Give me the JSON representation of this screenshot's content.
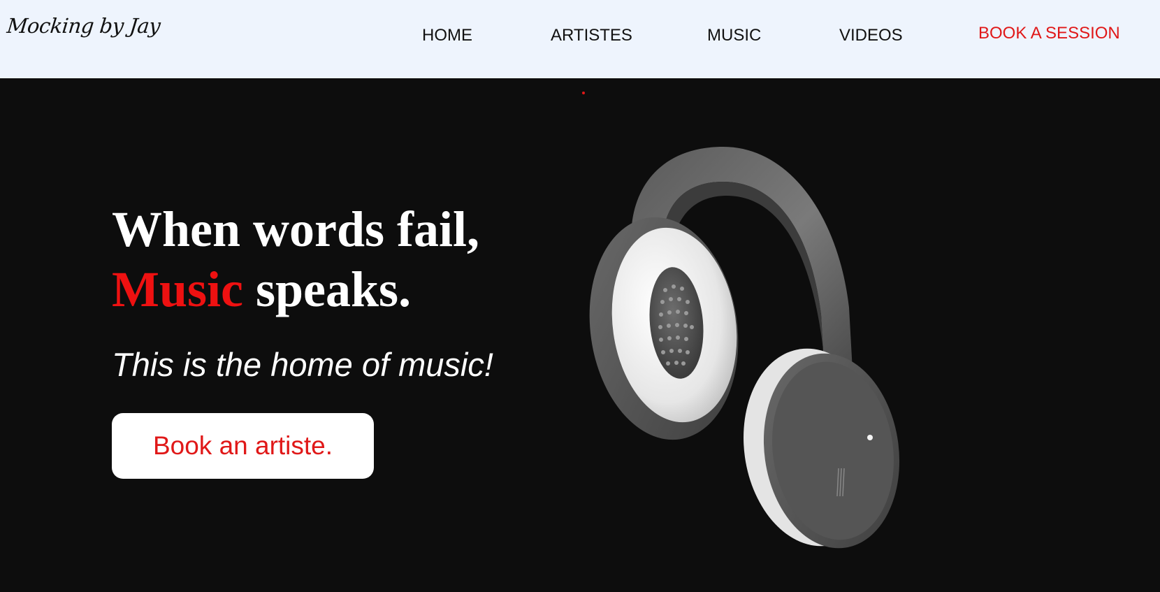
{
  "header": {
    "logo_text": "Mocking by Jay",
    "nav": [
      {
        "label": "HOME"
      },
      {
        "label": "ARTISTES"
      },
      {
        "label": "MUSIC"
      },
      {
        "label": "VIDEOS"
      }
    ],
    "cta_label": "BOOK A SESSION"
  },
  "hero": {
    "line1": "When words fail,",
    "line2_accent": "Music",
    "line2_rest": " speaks.",
    "subtitle": "This is the home of music!",
    "button_label": "Book an artiste."
  },
  "colors": {
    "header_bg": "#eef4fd",
    "page_bg": "#0d0d0d",
    "accent": "#e01818",
    "text_light": "#ffffff"
  },
  "icons": {
    "hero_image": "headphones-image"
  }
}
